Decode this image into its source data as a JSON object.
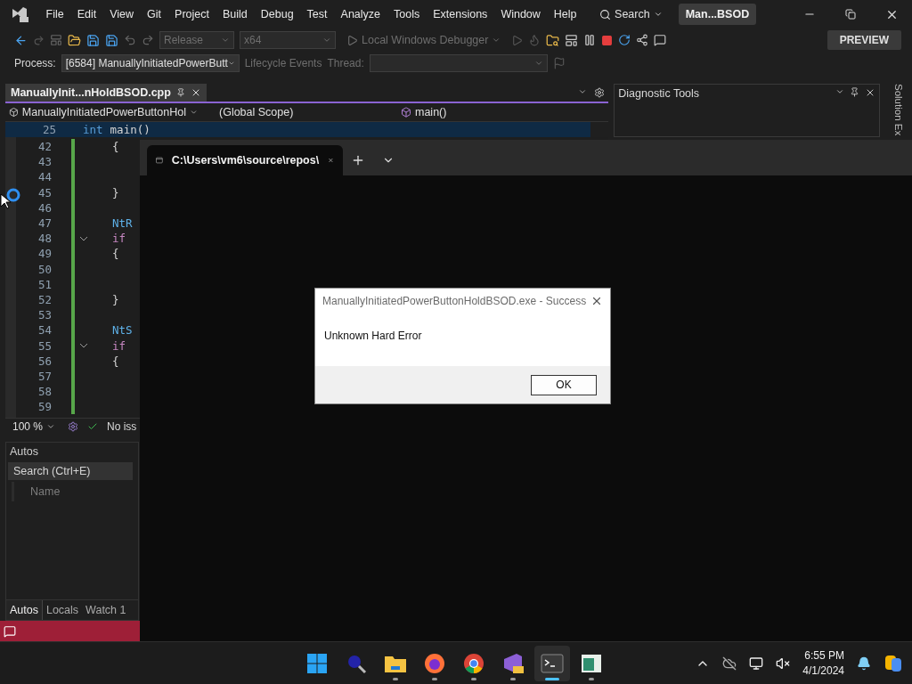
{
  "menu_bar": {
    "items": [
      "File",
      "Edit",
      "View",
      "Git",
      "Project",
      "Build",
      "Debug",
      "Test",
      "Analyze",
      "Tools",
      "Extensions",
      "Window",
      "Help"
    ],
    "search": "Search",
    "solution_name": "Man...BSOD"
  },
  "toolbar": {
    "configuration": {
      "label": "Release",
      "disabled": true
    },
    "platform": {
      "label": "x64",
      "disabled": true
    },
    "debugger": {
      "label": "Local Windows Debugger",
      "disabled": true
    },
    "preview": "PREVIEW"
  },
  "debug_location": {
    "process_label": "Process:",
    "process": "[6584] ManuallyInitiatedPowerButt",
    "lifecycle": "Lifecycle Events",
    "thread_label": "Thread:"
  },
  "editor": {
    "tabs": [
      {
        "label": "ManuallyInit...nHoldBSOD.cpp",
        "selected": true
      }
    ],
    "project": "ManuallyInitiatedPowerButtonHol",
    "scope": "(Global Scope)",
    "member": "main()",
    "sticky_line": {
      "number": "25",
      "tokens": [
        {
          "text": "int",
          "kind": "keyword"
        },
        {
          "text": "main()",
          "kind": "plain"
        }
      ]
    },
    "lines": [
      {
        "number": "42",
        "code": "{",
        "kind": "plain",
        "fold": false
      },
      {
        "number": "43",
        "kind": "blank",
        "fold": false
      },
      {
        "number": "44",
        "kind": "blank",
        "fold": false
      },
      {
        "number": "45",
        "code": "}",
        "kind": "plain",
        "fold": false
      },
      {
        "number": "46",
        "kind": "blank",
        "fold": false
      },
      {
        "number": "47",
        "code": "NtR",
        "kind": "call",
        "fold": false
      },
      {
        "number": "48",
        "code": "if",
        "kind": "keyword",
        "fold": true
      },
      {
        "number": "49",
        "code": "{",
        "kind": "plain",
        "fold": false
      },
      {
        "number": "50",
        "kind": "blank",
        "fold": false
      },
      {
        "number": "51",
        "kind": "blank",
        "fold": false
      },
      {
        "number": "52",
        "code": "}",
        "kind": "plain",
        "fold": false
      },
      {
        "number": "53",
        "kind": "blank",
        "fold": false
      },
      {
        "number": "54",
        "code": "NtS",
        "kind": "call",
        "fold": false
      },
      {
        "number": "55",
        "code": "if",
        "kind": "keyword",
        "fold": true
      },
      {
        "number": "56",
        "code": "{",
        "kind": "plain",
        "fold": false
      },
      {
        "number": "57",
        "kind": "blank",
        "fold": false
      },
      {
        "number": "58",
        "kind": "blank",
        "fold": false
      },
      {
        "number": "59",
        "kind": "blank",
        "fold": false
      }
    ],
    "zoom": "100 %",
    "issues": "No iss"
  },
  "diagnostic_tools": {
    "title": "Diagnostic Tools"
  },
  "solution_explorer_tab": "Solution Ex",
  "autos": {
    "title": "Autos",
    "search_placeholder": "Search (Ctrl+E)",
    "columns": [
      "Name"
    ],
    "tabs": [
      {
        "label": "Autos",
        "selected": true
      },
      {
        "label": "Locals",
        "selected": false
      },
      {
        "label": "Watch 1",
        "selected": false
      }
    ]
  },
  "terminal": {
    "tab_title": "C:\\Users\\vm6\\source\\repos\\"
  },
  "dialog": {
    "title": "ManuallyInitiatedPowerButtonHoldBSOD.exe - Success",
    "message": "Unknown Hard Error",
    "button": "OK"
  },
  "taskbar": {
    "apps": [
      {
        "kind": "start",
        "selected": false,
        "running": false
      },
      {
        "kind": "search",
        "selected": false,
        "running": false
      },
      {
        "kind": "explorer",
        "selected": false,
        "running": true
      },
      {
        "kind": "firefox",
        "selected": false,
        "running": true
      },
      {
        "kind": "chrome",
        "selected": false,
        "running": true
      },
      {
        "kind": "visual-studio",
        "selected": false,
        "running": true
      },
      {
        "kind": "terminal",
        "selected": true,
        "running": true
      },
      {
        "kind": "app",
        "selected": false,
        "running": true
      }
    ],
    "time": "6:55 PM",
    "date": "4/1/2024"
  }
}
